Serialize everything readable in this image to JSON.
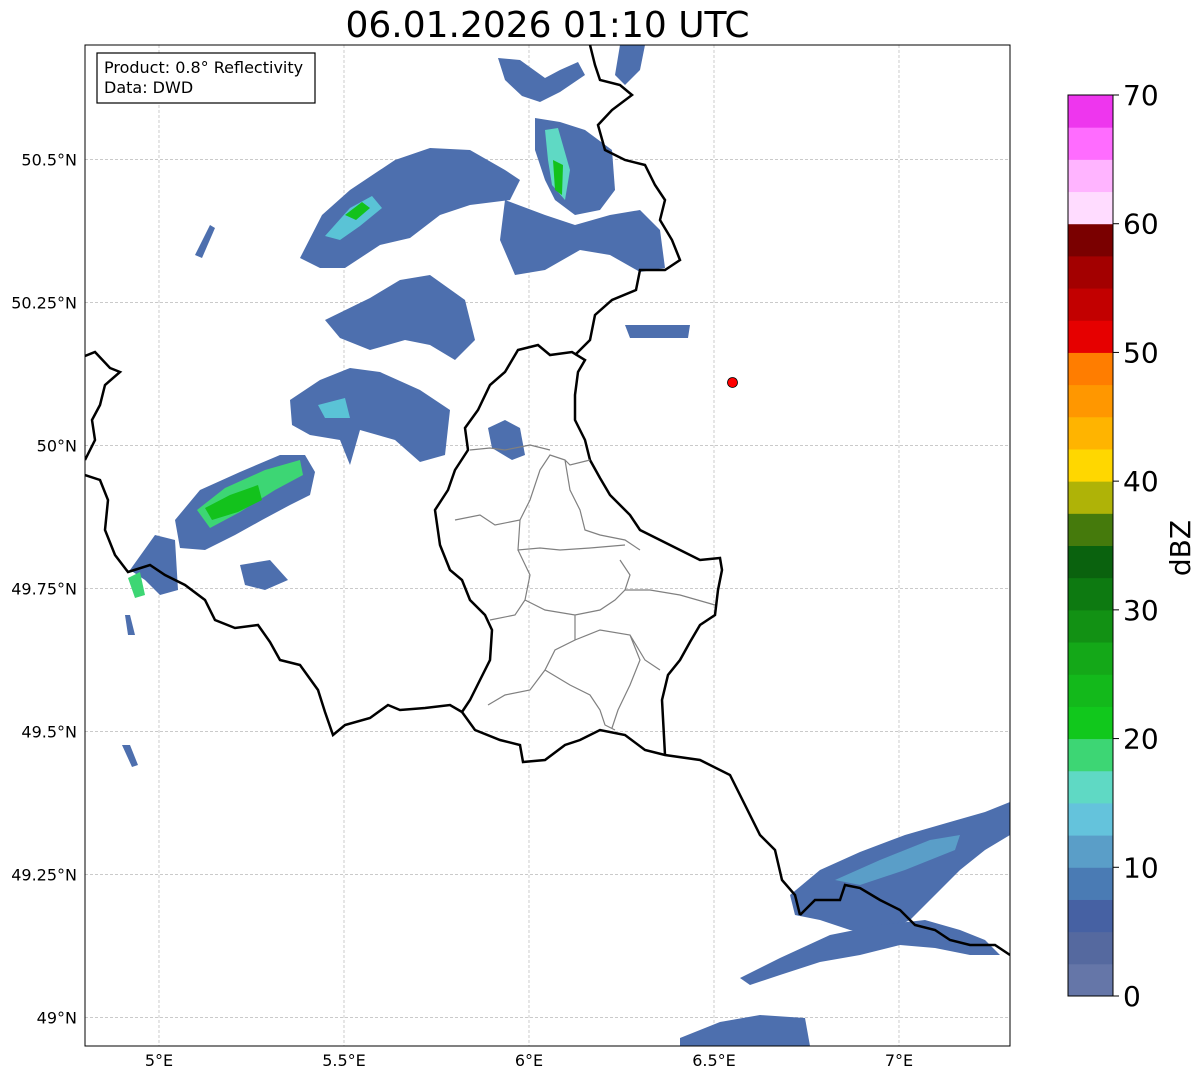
{
  "title": "06.01.2026 01:10 UTC",
  "info": {
    "product": "Product: 0.8° Reflectivity",
    "data": "Data: DWD"
  },
  "map": {
    "extent": {
      "lon_min": 4.8,
      "lon_max": 7.3,
      "lat_min": 48.95,
      "lat_max": 50.7
    },
    "lon_ticks": [
      {
        "value": 5.0,
        "label": "5°E"
      },
      {
        "value": 5.5,
        "label": "5.5°E"
      },
      {
        "value": 6.0,
        "label": "6°E"
      },
      {
        "value": 6.5,
        "label": "6.5°E"
      },
      {
        "value": 7.0,
        "label": "7°E"
      }
    ],
    "lat_ticks": [
      {
        "value": 49.0,
        "label": "49°N"
      },
      {
        "value": 49.25,
        "label": "49.25°N"
      },
      {
        "value": 49.5,
        "label": "49.5°N"
      },
      {
        "value": 49.75,
        "label": "49.75°N"
      },
      {
        "value": 50.0,
        "label": "50°N"
      },
      {
        "value": 50.25,
        "label": "50.25°N"
      },
      {
        "value": 50.5,
        "label": "50.5°N"
      }
    ],
    "radar_site": {
      "lon": 6.55,
      "lat": 50.11,
      "color": "#ff0000"
    },
    "country_border_color": "#000000",
    "district_border_color": "#808080",
    "gridlines": true
  },
  "colorbar": {
    "label": "dBZ",
    "min": 0,
    "max": 70,
    "step": 2.5,
    "ticks": [
      {
        "value": 0,
        "label": "0"
      },
      {
        "value": 10,
        "label": "10"
      },
      {
        "value": 20,
        "label": "20"
      },
      {
        "value": 30,
        "label": "30"
      },
      {
        "value": 40,
        "label": "40"
      },
      {
        "value": 50,
        "label": "50"
      },
      {
        "value": 60,
        "label": "60"
      },
      {
        "value": 70,
        "label": "70"
      }
    ],
    "colors": [
      "#6576a8",
      "#55699f",
      "#4661a3",
      "#4a7bb4",
      "#5a9ec8",
      "#64c3dc",
      "#5fd9c4",
      "#3dd674",
      "#11c81c",
      "#13b91b",
      "#14a818",
      "#129114",
      "#0d7a11",
      "#0a620e",
      "#457a0c",
      "#afb307",
      "#ffd700",
      "#ffb400",
      "#ff9700",
      "#ff7d00",
      "#e60000",
      "#c20000",
      "#a30000",
      "#7a0000",
      "#ffdcff",
      "#ffb4ff",
      "#ff6cff",
      "#ee36ee"
    ]
  }
}
